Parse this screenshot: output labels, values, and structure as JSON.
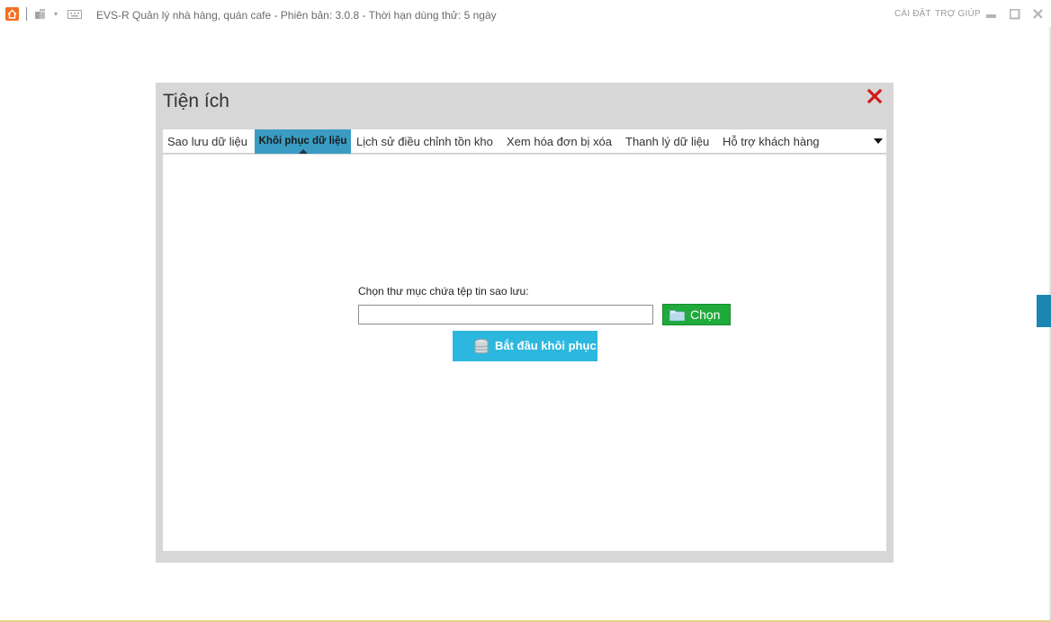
{
  "titlebar": {
    "title": "EVS-R Quản lý nhà hàng, quán cafe - Phiên bản: 3.0.8 - Thời hạn dùng thử: 5 ngày",
    "settings_label": "CÀI ĐẶT",
    "help_label": "TRỢ GIÚP",
    "drop_arrow": "▾"
  },
  "dialog": {
    "title": "Tiện ích",
    "tabs": [
      "Sao lưu dữ liệu",
      "Khôi phục dữ liệu",
      "Lịch sử điều chỉnh tồn kho",
      "Xem hóa đơn bị xóa",
      "Thanh lý dữ liệu",
      "Hỗ trợ khách hàng"
    ],
    "active_tab": "Khôi phục dữ liệu"
  },
  "restore": {
    "folder_label": "Chọn thư mục chứa tệp tin sao lưu:",
    "path_value": "",
    "choose_button": "Chọn",
    "start_button": "Bắt đầu khôi phục"
  },
  "colors": {
    "active_tab": "#3a9cc2",
    "choose_button": "#1faa3c",
    "start_button": "#2cb7de",
    "close_icon": "#d21a1a",
    "app_icon": "#f36f21"
  },
  "icons": [
    "home-icon",
    "building-icon",
    "keyboard-icon",
    "minimize-icon",
    "maximize-icon",
    "close-icon",
    "chevron-down-icon",
    "folder-icon",
    "database-icon"
  ]
}
